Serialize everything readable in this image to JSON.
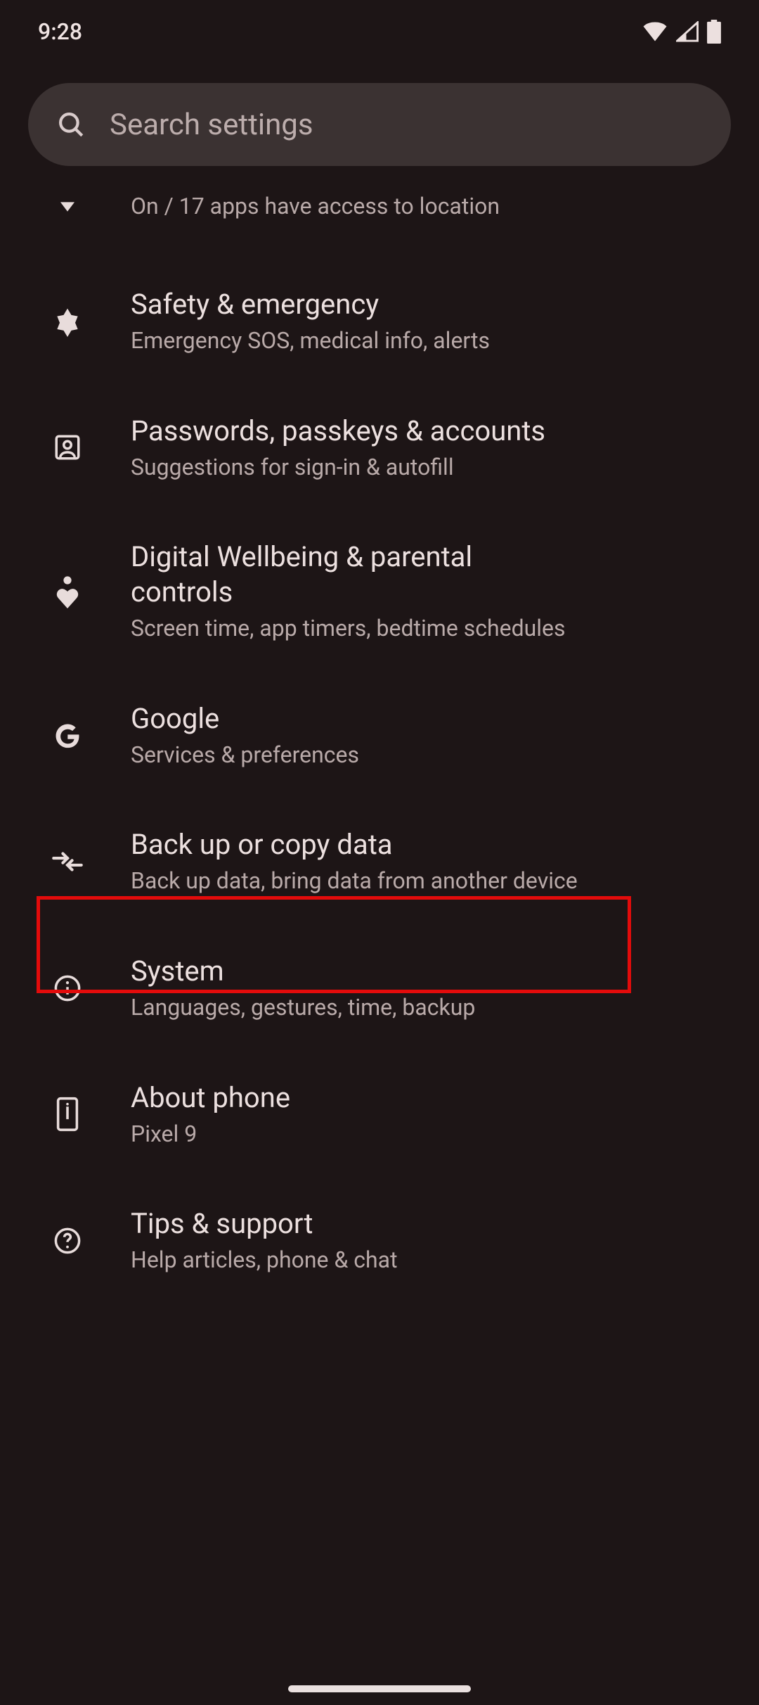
{
  "status": {
    "time": "9:28"
  },
  "search": {
    "placeholder": "Search settings"
  },
  "partial_item": {
    "subtitle": "On / 17 apps have access to location"
  },
  "items": [
    {
      "id": "safety",
      "title": "Safety & emergency",
      "subtitle": "Emergency SOS, medical info, alerts"
    },
    {
      "id": "passwords",
      "title": "Passwords, passkeys & accounts",
      "subtitle": "Suggestions for sign-in & autofill"
    },
    {
      "id": "wellbeing",
      "title": "Digital Wellbeing & parental controls",
      "subtitle": "Screen time, app timers, bedtime schedules"
    },
    {
      "id": "google",
      "title": "Google",
      "subtitle": "Services & preferences"
    },
    {
      "id": "backup",
      "title": "Back up or copy data",
      "subtitle": "Back up data, bring data from another device"
    },
    {
      "id": "system",
      "title": "System",
      "subtitle": "Languages, gestures, time, backup"
    },
    {
      "id": "about",
      "title": "About phone",
      "subtitle": "Pixel 9"
    },
    {
      "id": "tips",
      "title": "Tips & support",
      "subtitle": "Help articles, phone & chat"
    }
  ]
}
